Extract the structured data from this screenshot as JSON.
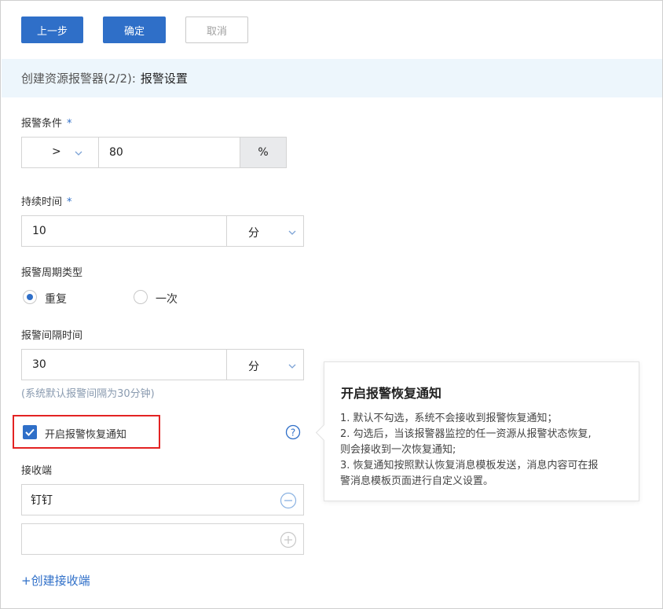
{
  "toolbar": {
    "prev_label": "上一步",
    "confirm_label": "确定",
    "cancel_label": "取消"
  },
  "header": {
    "prefix": "创建资源报警器(2/2):",
    "title": "报警设置"
  },
  "condition": {
    "label": "报警条件",
    "required_mark": "*",
    "operator": ">",
    "value": "80",
    "unit": "%"
  },
  "duration": {
    "label": "持续时间",
    "required_mark": "*",
    "value": "10",
    "unit": "分"
  },
  "period_type": {
    "label": "报警周期类型",
    "options": [
      {
        "label": "重复",
        "checked": true
      },
      {
        "label": "一次",
        "checked": false
      }
    ]
  },
  "interval": {
    "label": "报警间隔时间",
    "value": "30",
    "unit": "分",
    "hint": "(系统默认报警间隔为30分钟)"
  },
  "recovery": {
    "label": "开启报警恢复通知",
    "checked": true
  },
  "receivers": {
    "label": "接收端",
    "items": [
      {
        "value": "钉钉"
      },
      {
        "value": ""
      }
    ],
    "create_link": "+创建接收端"
  },
  "tooltip": {
    "title": "开启报警恢复通知",
    "lines": [
      "1. 默认不勾选，系统不会接收到报警恢复通知；",
      "2. 勾选后，当该报警器监控的任一资源从报警状态恢复,",
      "则会接收到一次恢复通知;",
      "3. 恢复通知按照默认恢复消息模板发送，消息内容可在报",
      "警消息模板页面进行自定义设置。"
    ]
  },
  "colors": {
    "accent": "#2f6fc8",
    "header_bg": "#edf6fc",
    "highlight": "#e32323"
  }
}
